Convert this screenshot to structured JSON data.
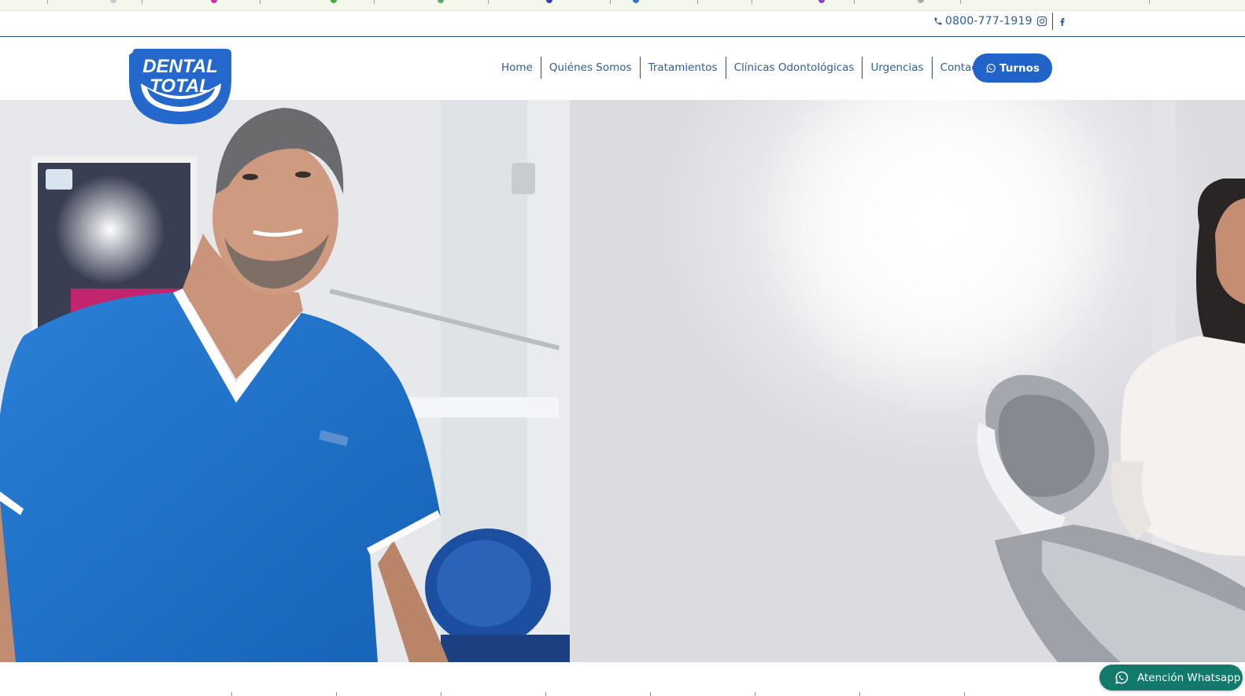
{
  "contact": {
    "phone": "0800-777-1919"
  },
  "brand": {
    "line1": "DENTAL",
    "line2": "TOTAL"
  },
  "nav": {
    "items": [
      {
        "label": "Home"
      },
      {
        "label": "Quiénes Somos"
      },
      {
        "label": "Tratamientos"
      },
      {
        "label": "Clínicas Odontológicas"
      },
      {
        "label": "Urgencias"
      },
      {
        "label": "Contacto"
      }
    ],
    "cta_label": "Turnos"
  },
  "whatsapp": {
    "label": "Atención Whatsapp"
  },
  "colors": {
    "brand_blue": "#2163c9",
    "link_blue": "#2f5c9a",
    "whatsapp_green": "#117a6a",
    "scrub_blue": "#1e70c8"
  },
  "icons": [
    "phone-icon",
    "instagram-icon",
    "facebook-icon",
    "whatsapp-icon"
  ]
}
